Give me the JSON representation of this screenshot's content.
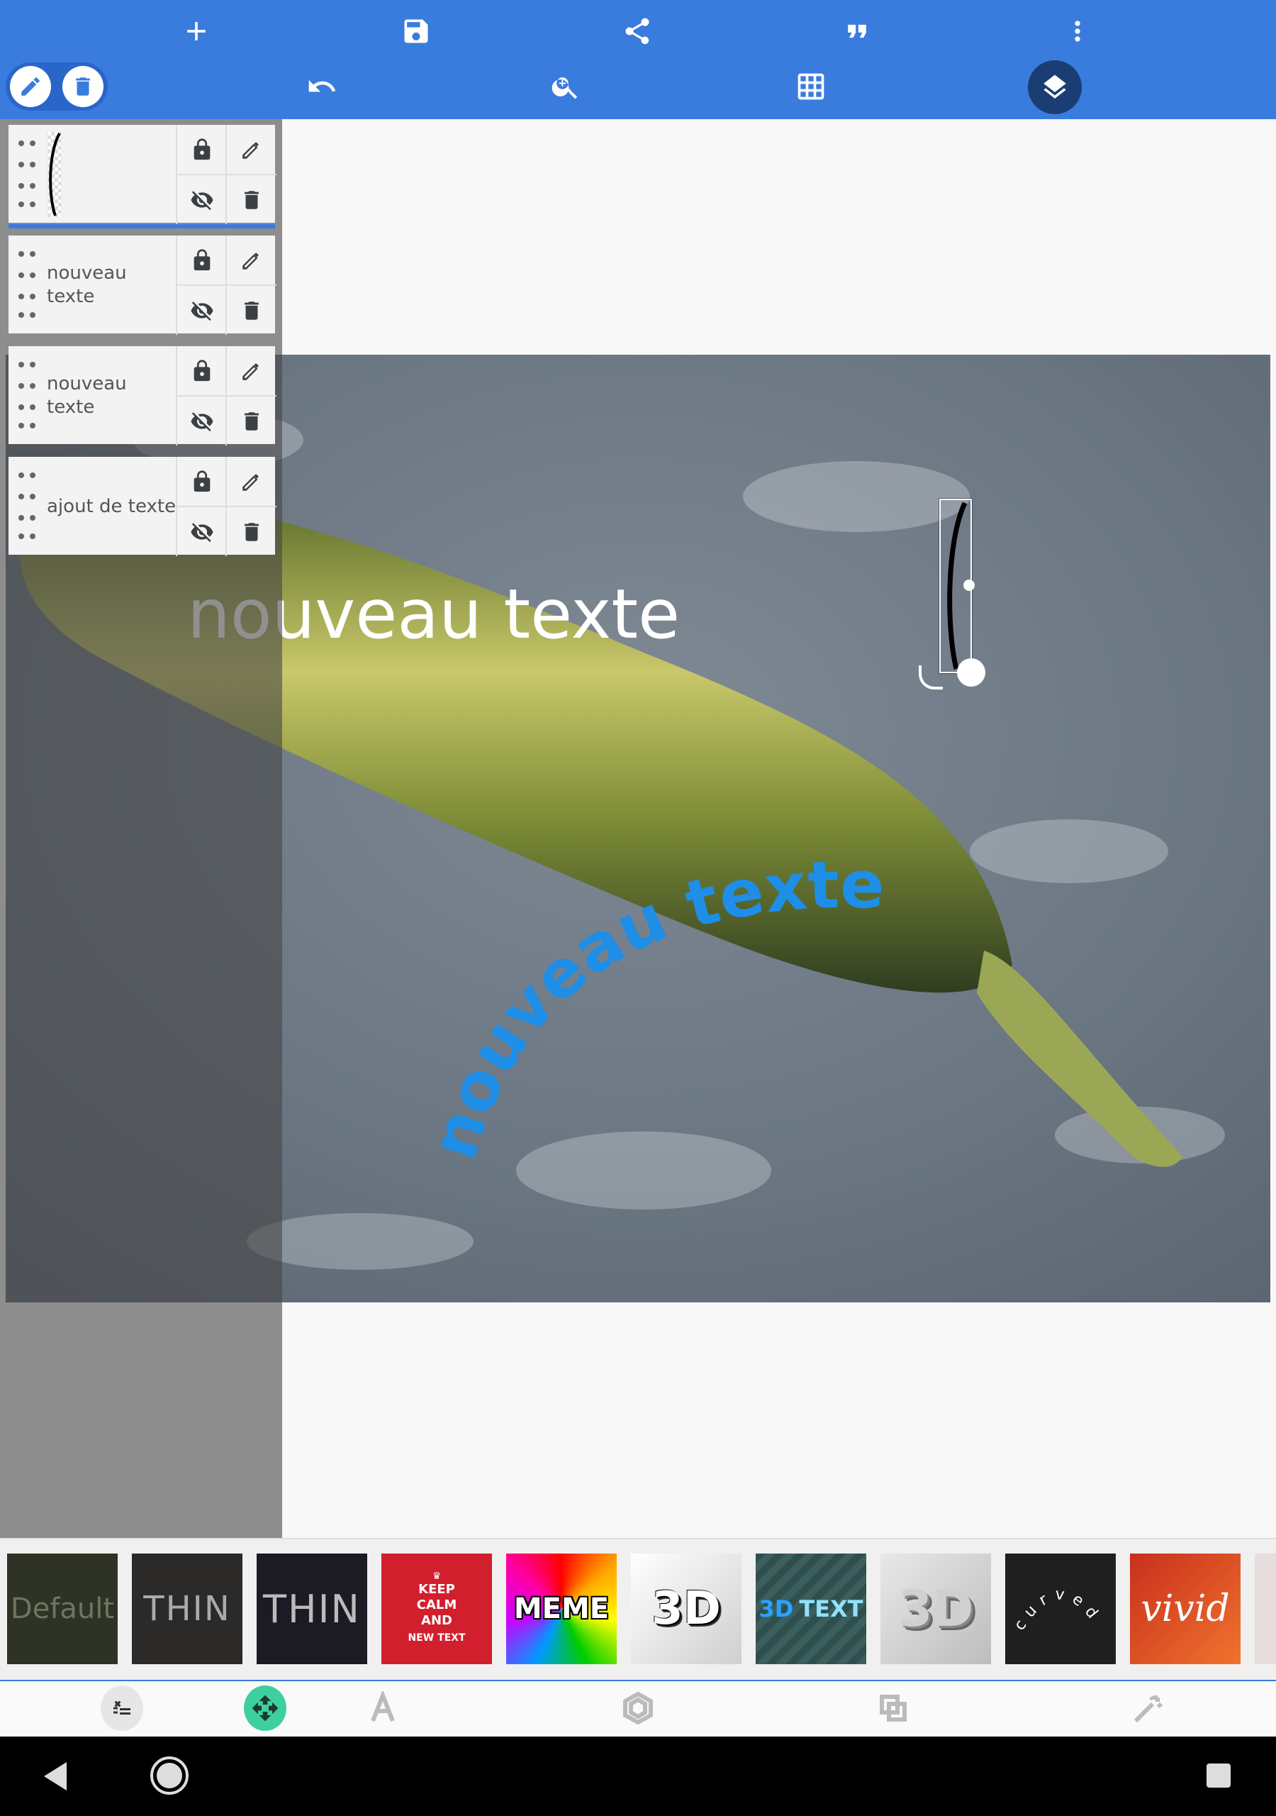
{
  "toolbar": {
    "icons": [
      "add-icon",
      "save-icon",
      "share-icon",
      "quote-icon",
      "more-vert-icon",
      "edit-icon",
      "delete-icon",
      "undo-icon",
      "zoom-in-icon",
      "grid-icon",
      "layers-icon"
    ]
  },
  "layers": [
    {
      "name": "layer-image",
      "label": ""
    },
    {
      "name": "layer-nouveau-texte-1",
      "label": "nouveau texte"
    },
    {
      "name": "layer-nouveau-texte-2",
      "label": "nouveau texte"
    },
    {
      "name": "layer-ajout-de-texte",
      "label": "ajout de texte"
    }
  ],
  "canvas": {
    "text_horizontal": "nouveau texte",
    "text_curved": "nouveau texte",
    "text_curved_color": "#1e8ee6"
  },
  "styles": {
    "default": "Default",
    "thin1": "THIN",
    "thin2": "THIN",
    "keep_calm_lines": [
      "KEEP",
      "CALM",
      "AND",
      "NEW TEXT"
    ],
    "meme": "MEME",
    "three_d": "3D",
    "three_d_text_a": "3D",
    "three_d_text_b": "TEXT",
    "three_d_b": "3D",
    "curved": "curved",
    "vivid": "vivid"
  },
  "colors": {
    "accent": "#3a7bde",
    "layers_button": "#1a3d73",
    "curved_text": "#1e8ee6"
  }
}
